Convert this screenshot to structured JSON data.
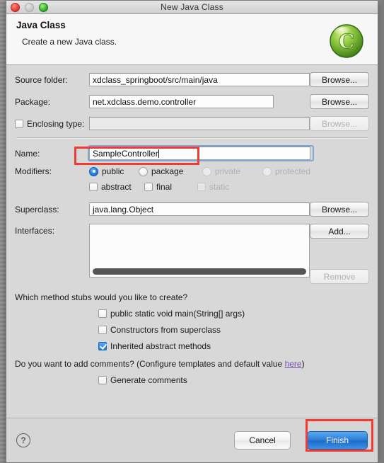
{
  "window": {
    "title": "New Java Class",
    "traffic_lights": [
      "close-light",
      "minimize-light",
      "zoom-light"
    ]
  },
  "header": {
    "heading": "Java Class",
    "subtitle": "Create a new Java class.",
    "icon": "java-class-green-c-icon"
  },
  "form": {
    "source_folder": {
      "label": "Source folder:",
      "value": "xdclass_springboot/src/main/java",
      "browse": "Browse..."
    },
    "package": {
      "label": "Package:",
      "value": "net.xdclass.demo.controller",
      "browse": "Browse..."
    },
    "enclosing_type": {
      "label": "Enclosing type:",
      "value": "",
      "checked": false,
      "browse": "Browse...",
      "browse_disabled": true
    },
    "name": {
      "label": "Name:",
      "value": "SampleController",
      "focused": true,
      "highlighted": true
    },
    "modifiers": {
      "label": "Modifiers:",
      "radios": [
        {
          "label": "public",
          "selected": true,
          "disabled": false
        },
        {
          "label": "package",
          "selected": false,
          "disabled": false
        },
        {
          "label": "private",
          "selected": false,
          "disabled": true
        },
        {
          "label": "protected",
          "selected": false,
          "disabled": true
        }
      ],
      "checkboxes": [
        {
          "label": "abstract",
          "checked": false,
          "disabled": false
        },
        {
          "label": "final",
          "checked": false,
          "disabled": false
        },
        {
          "label": "static",
          "checked": false,
          "disabled": true
        }
      ]
    },
    "superclass": {
      "label": "Superclass:",
      "value": "java.lang.Object",
      "browse": "Browse..."
    },
    "interfaces": {
      "label": "Interfaces:",
      "items": [],
      "add": "Add...",
      "remove": "Remove",
      "remove_disabled": true
    },
    "stubs": {
      "question": "Which method stubs would you like to create?",
      "options": [
        {
          "label": "public static void main(String[] args)",
          "checked": false
        },
        {
          "label": "Constructors from superclass",
          "checked": false
        },
        {
          "label": "Inherited abstract methods",
          "checked": true
        }
      ]
    },
    "comments": {
      "question_prefix": "Do you want to add comments? (Configure templates and default value ",
      "link": "here",
      "question_suffix": ")",
      "option": {
        "label": "Generate comments",
        "checked": false
      }
    }
  },
  "footer": {
    "help": "?",
    "cancel": "Cancel",
    "finish": "Finish",
    "finish_highlighted": true
  },
  "colors": {
    "accent_blue": "#2f80d8",
    "highlight_red": "#ee3b33",
    "link_purple": "#7b4fb0",
    "checked_blue": "#1d7fe0"
  }
}
